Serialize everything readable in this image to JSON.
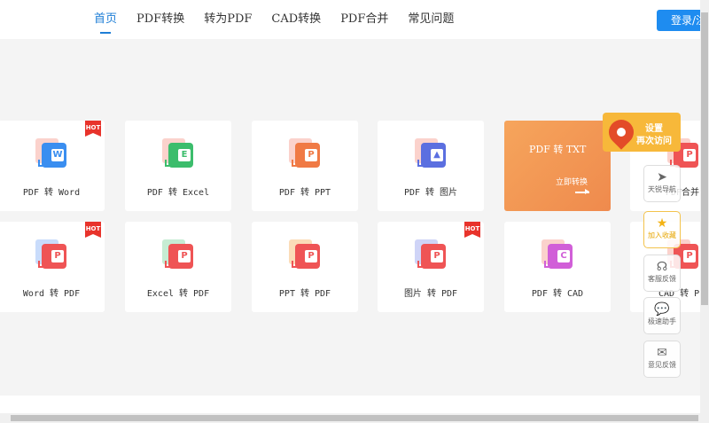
{
  "nav": {
    "items": [
      "首页",
      "PDF转换",
      "转为PDF",
      "CAD转换",
      "PDF合并",
      "常见问题"
    ],
    "login": "登录/注册"
  },
  "hot_label": "HOT",
  "cards": {
    "row1": [
      "PDF 转 Word",
      "PDF 转 Excel",
      "PDF 转 PPT",
      "PDF 转 图片",
      "PDF合并"
    ],
    "row2": [
      "Word 转 PDF",
      "Excel 转 PDF",
      "PPT 转 PDF",
      "图片 转 PDF",
      "PDF 转 CAD",
      "CAD 转 P"
    ]
  },
  "icon_letters": {
    "word": "W",
    "excel": "E",
    "pdf": "P",
    "cad": "C"
  },
  "promo": {
    "title": "PDF 转 TXT",
    "action": "立即转换"
  },
  "sidebar": {
    "setting_line1": "设置",
    "setting_line2": "再次访问",
    "nav_label": "天锐导航",
    "fav_label": "加入收藏",
    "service_label": "客服反馈",
    "assistant_label": "极速助手",
    "feedback_label": "意见反馈"
  },
  "colors": {
    "accent": "#1e7ed6",
    "word": "#3a8ef0",
    "excel": "#3cbd6c",
    "ppt": "#f07a45",
    "image": "#5b6fe0",
    "pdf": "#ef5455",
    "cad": "#d15fd8",
    "hot": "#e8332b"
  }
}
